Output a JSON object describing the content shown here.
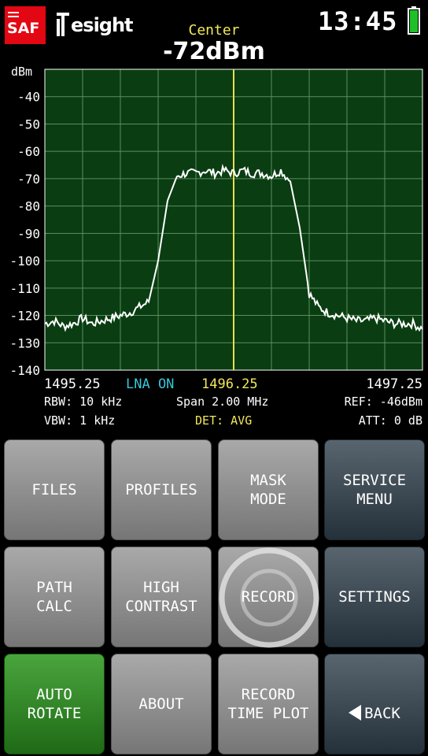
{
  "header": {
    "brand_saf": "SAF",
    "brand_name": "esight",
    "center_label": "Center",
    "center_value": "-72dBm",
    "time": "13:45",
    "battery_color": "#1fbf2a"
  },
  "chart_data": {
    "type": "line",
    "ylabel": "dBm",
    "ylim": [
      -140,
      -30
    ],
    "yticks": [
      -40,
      -50,
      -60,
      -70,
      -80,
      -90,
      -100,
      -110,
      -120,
      -130,
      -140
    ],
    "xlim": [
      1495.25,
      1497.25
    ],
    "center_marker": 1496.25,
    "grid": true,
    "background": "#0a3d12",
    "grid_color": "#5a8f5f",
    "trace_color": "#ffffff",
    "marker_color": "#e8e04a",
    "series": [
      {
        "x": [
          1495.25,
          1495.3,
          1495.35,
          1495.4,
          1495.45,
          1495.5,
          1495.55,
          1495.6,
          1495.65,
          1495.7,
          1495.75,
          1495.8,
          1495.85,
          1495.9,
          1495.95,
          1496.0,
          1496.05,
          1496.1,
          1496.15,
          1496.2,
          1496.25,
          1496.3,
          1496.35,
          1496.4,
          1496.45,
          1496.5,
          1496.55,
          1496.6,
          1496.65,
          1496.7,
          1496.75,
          1496.8,
          1496.85,
          1496.9,
          1496.95,
          1497.0,
          1497.05,
          1497.1,
          1497.15,
          1497.2,
          1497.25
        ],
        "values": [
          -123,
          -122,
          -124,
          -123,
          -121,
          -123,
          -122,
          -121,
          -120,
          -119,
          -117,
          -115,
          -100,
          -78,
          -69,
          -68,
          -68,
          -67,
          -68,
          -67,
          -68,
          -67,
          -68,
          -68,
          -69,
          -67,
          -71,
          -88,
          -112,
          -117,
          -119,
          -120,
          -121,
          -122,
          -122,
          -121,
          -122,
          -123,
          -123,
          -123,
          -125
        ]
      }
    ]
  },
  "readout": {
    "freq_left": "1495.25",
    "lna": "LNA ON",
    "freq_center": "1496.25",
    "freq_right": "1497.25",
    "rbw": "RBW: 10 kHz",
    "span": "Span 2.00 MHz",
    "ref": "REF: -46dBm",
    "vbw": "VBW: 1 kHz",
    "det": "DET: AVG",
    "att": "ATT:  0 dB",
    "lna_color": "#35c6d8",
    "center_color": "#f2e85a",
    "det_color": "#f2e85a"
  },
  "buttons": {
    "files": "FILES",
    "profiles": "PROFILES",
    "mask_mode": "MASK\nMODE",
    "service_menu": "SERVICE\nMENU",
    "path_calc": "PATH\nCALC",
    "high_contrast": "HIGH\nCONTRAST",
    "record": "RECORD",
    "settings": "SETTINGS",
    "auto_rotate": "AUTO\nROTATE",
    "about": "ABOUT",
    "record_time_plot": "RECORD\nTIME PLOT",
    "back": "BACK"
  },
  "icons": {
    "back": "left-triangle-icon",
    "record": "record-ring-icon",
    "battery": "battery-icon"
  }
}
